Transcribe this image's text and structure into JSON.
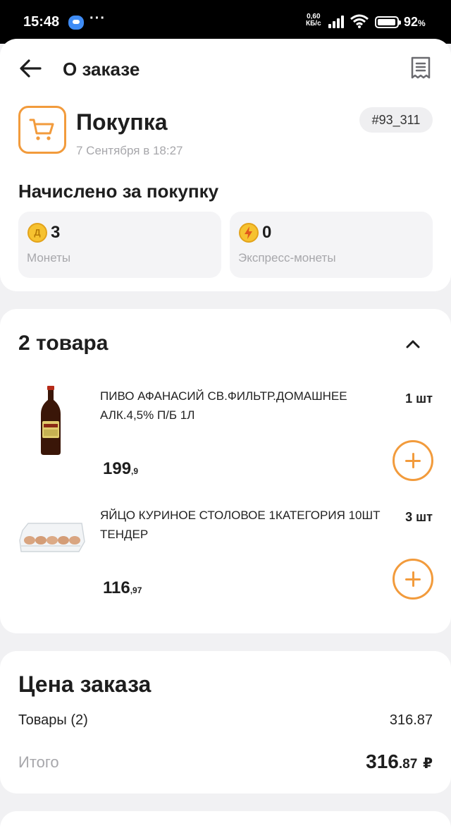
{
  "status_bar": {
    "time": "15:48",
    "dots": "···",
    "speed_value": "0,60",
    "speed_unit": "КБ/с",
    "battery": "92",
    "battery_unit": "%"
  },
  "header": {
    "title": "О заказе"
  },
  "purchase": {
    "title": "Покупка",
    "date": "7 Сентября в 18:27",
    "order_number": "#93_311"
  },
  "accrued": {
    "title": "Начислено за покупку",
    "coins": {
      "value": "3",
      "label": "Монеты",
      "icon": "coin-icon"
    },
    "express": {
      "value": "0",
      "label": "Экспресс-монеты",
      "icon": "lightning-coin-icon"
    }
  },
  "items": {
    "title": "2 товара",
    "list": [
      {
        "name": "ПИВО АФАНАСИЙ СВ.ФИЛЬТР.ДОМАШНЕЕ АЛК.4,5% П/Б 1Л",
        "qty": "1 шт",
        "price_main": "199",
        "price_cents": ",9"
      },
      {
        "name": "ЯЙЦО КУРИНОЕ СТОЛОВОЕ 1КАТЕГОРИЯ 10ШТ ТЕНДЕР",
        "qty": "3 шт",
        "price_main": "116",
        "price_cents": ",97"
      }
    ]
  },
  "price": {
    "title": "Цена заказа",
    "goods_label": "Товары (2)",
    "goods_value": "316.87",
    "total_label": "Итого",
    "total_main": "316",
    "total_cents": ".87",
    "currency": "₽"
  },
  "colors": {
    "accent": "#f29b3c",
    "muted_text": "#a7a7ab",
    "background": "#f1f1f3"
  }
}
